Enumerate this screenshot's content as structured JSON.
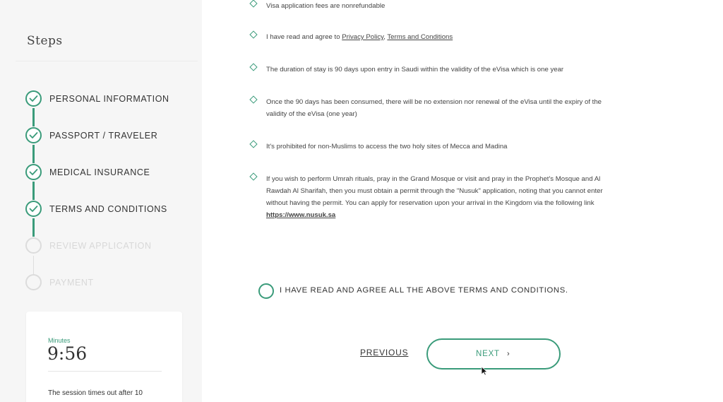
{
  "sidebar": {
    "title": "Steps",
    "steps": [
      {
        "label": "PERSONAL INFORMATION",
        "status": "completed"
      },
      {
        "label": "PASSPORT / TRAVELER",
        "status": "completed"
      },
      {
        "label": "MEDICAL INSURANCE",
        "status": "completed"
      },
      {
        "label": "TERMS AND CONDITIONS",
        "status": "completed"
      },
      {
        "label": "REVIEW APPLICATION",
        "status": "pending"
      },
      {
        "label": "PAYMENT",
        "status": "pending"
      }
    ],
    "timer": {
      "label": "Minutes",
      "value": "9:56",
      "message": "The session times out after 10"
    }
  },
  "terms": {
    "items": [
      {
        "text": "Visa application fees are nonrefundable"
      },
      {
        "prefix": "I have read and agree to ",
        "link1": "Privacy Policy",
        "sep": ", ",
        "link2": "Terms and Conditions"
      },
      {
        "text": "The duration of stay is 90 days upon entry in Saudi within the validity of the eVisa which is one year"
      },
      {
        "text": "Once the 90 days has been consumed, there will be no extension nor renewal of the eVisa until the expiry of the validity of the eVisa (one year)"
      },
      {
        "text": "It's prohibited for non-Muslims to access the two holy sites of Mecca and Madina"
      },
      {
        "text": "If you wish to perform Umrah rituals, pray in the Grand Mosque or visit and pray in the Prophet's Mosque and Al Rawdah Al Sharifah, then you must obtain a permit through the \"Nusuk\" application, noting that you cannot enter without having the permit. You can apply for reservation upon your arrival in the Kingdom via the following link ",
        "link": "https://www.nusuk.sa"
      }
    ],
    "agree_label": "I HAVE READ AND AGREE ALL THE ABOVE TERMS AND CONDITIONS."
  },
  "nav": {
    "previous_label": "PREVIOUS",
    "next_label": "NEXT",
    "next_icon": "chevron-right-icon"
  },
  "colors": {
    "accent": "#3a9b7a",
    "sidebar_bg": "#f6f6f6",
    "pending": "#dcdcdc"
  }
}
